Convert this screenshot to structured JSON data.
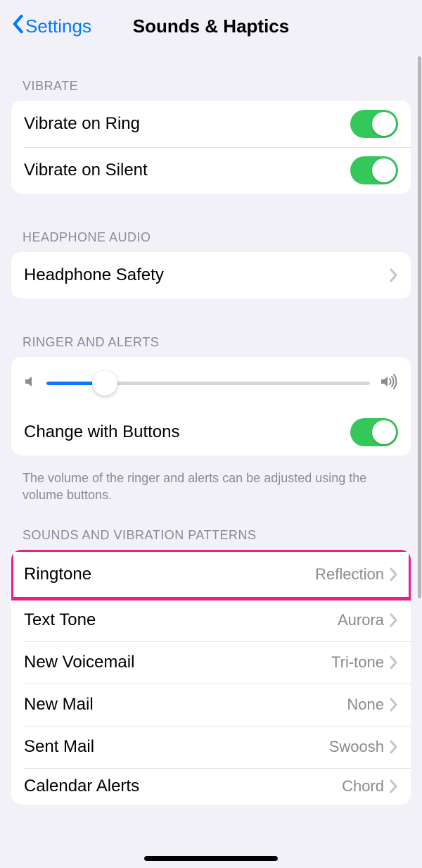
{
  "nav": {
    "back_label": "Settings",
    "title": "Sounds & Haptics"
  },
  "sections": {
    "vibrate": {
      "header": "VIBRATE",
      "rows": [
        {
          "label": "Vibrate on Ring",
          "toggle": true
        },
        {
          "label": "Vibrate on Silent",
          "toggle": true
        }
      ]
    },
    "headphone": {
      "header": "HEADPHONE AUDIO",
      "rows": [
        {
          "label": "Headphone Safety"
        }
      ]
    },
    "ringer": {
      "header": "RINGER AND ALERTS",
      "slider_value_percent": 18,
      "change_label": "Change with Buttons",
      "change_toggle": true,
      "footer": "The volume of the ringer and alerts can be adjusted using the volume buttons."
    },
    "sounds": {
      "header": "SOUNDS AND VIBRATION PATTERNS",
      "rows": [
        {
          "label": "Ringtone",
          "value": "Reflection",
          "highlight": true
        },
        {
          "label": "Text Tone",
          "value": "Aurora"
        },
        {
          "label": "New Voicemail",
          "value": "Tri-tone"
        },
        {
          "label": "New Mail",
          "value": "None"
        },
        {
          "label": "Sent Mail",
          "value": "Swoosh"
        },
        {
          "label": "Calendar Alerts",
          "value": "Chord"
        }
      ]
    }
  },
  "colors": {
    "accent_blue": "#007aff",
    "toggle_green": "#34c759",
    "highlight_pink": "#e91e8c"
  }
}
